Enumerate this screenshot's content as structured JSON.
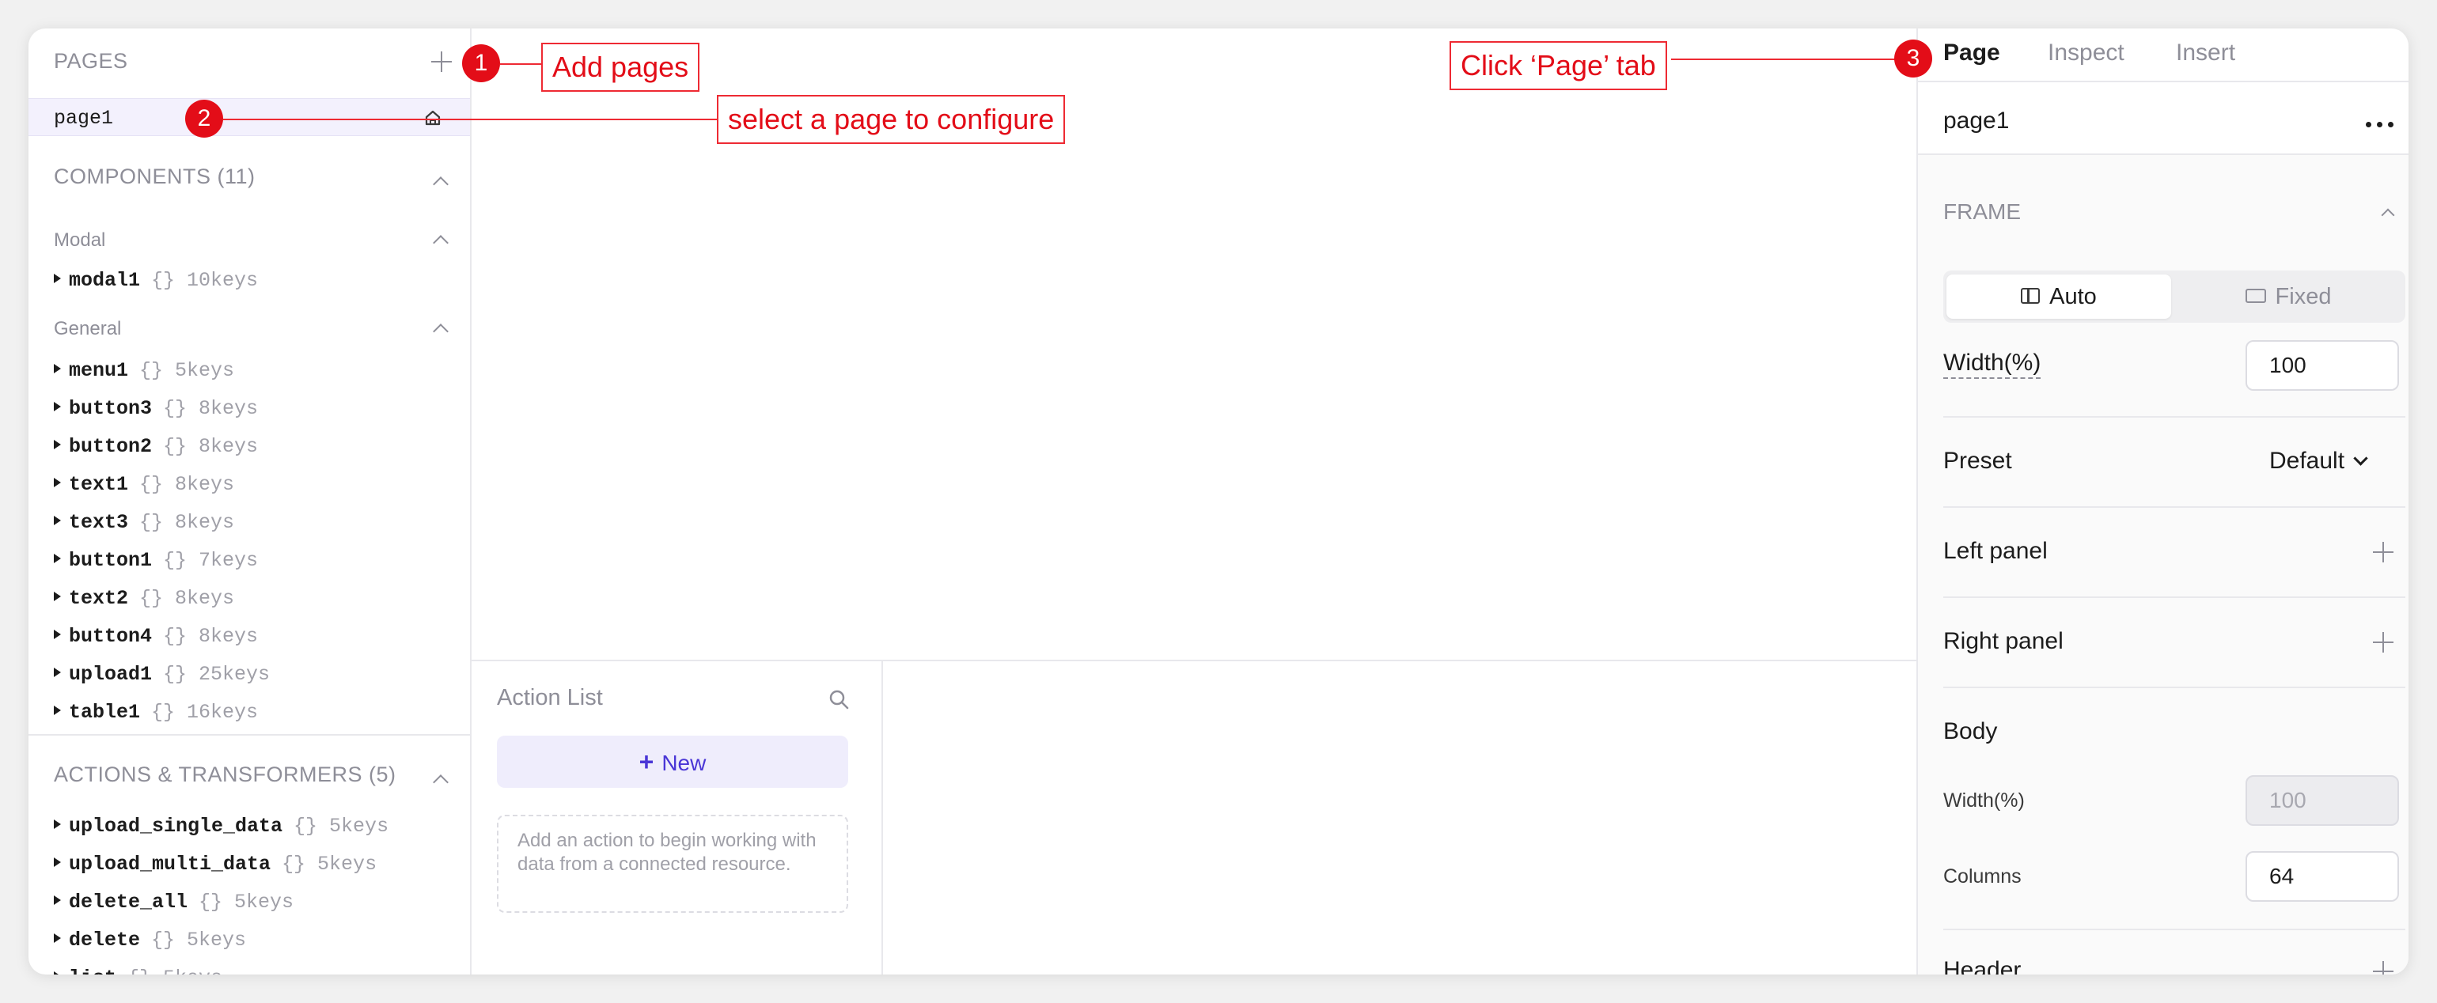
{
  "left_panel": {
    "pages_header": "PAGES",
    "pages": [
      {
        "name": "page1"
      }
    ],
    "components_header": "COMPONENTS (11)",
    "groups": [
      {
        "name": "Modal",
        "items": [
          {
            "name": "modal1",
            "keys": "{} 10keys"
          }
        ]
      },
      {
        "name": "General",
        "items": [
          {
            "name": "menu1",
            "keys": "{} 5keys"
          },
          {
            "name": "button3",
            "keys": "{} 8keys"
          },
          {
            "name": "button2",
            "keys": "{} 8keys"
          },
          {
            "name": "text1",
            "keys": "{} 8keys"
          },
          {
            "name": "text3",
            "keys": "{} 8keys"
          },
          {
            "name": "button1",
            "keys": "{} 7keys"
          },
          {
            "name": "text2",
            "keys": "{} 8keys"
          },
          {
            "name": "button4",
            "keys": "{} 8keys"
          },
          {
            "name": "upload1",
            "keys": "{} 25keys"
          },
          {
            "name": "table1",
            "keys": "{} 16keys"
          }
        ]
      }
    ],
    "actions_header": "ACTIONS & TRANSFORMERS (5)",
    "actions": [
      {
        "name": "upload_single_data",
        "keys": "{} 5keys"
      },
      {
        "name": "upload_multi_data",
        "keys": "{} 5keys"
      },
      {
        "name": "delete_all",
        "keys": "{} 5keys"
      },
      {
        "name": "delete",
        "keys": "{} 5keys"
      },
      {
        "name": "list",
        "keys": "{} 5keys"
      }
    ]
  },
  "action_list": {
    "title": "Action List",
    "new_label": "New",
    "empty_text": "Add an action to begin working with data from a connected resource."
  },
  "right_panel": {
    "tabs": [
      "Page",
      "Inspect",
      "Insert"
    ],
    "active_tab": "Page",
    "page_name": "page1",
    "frame_header": "FRAME",
    "frame_options": [
      "Auto",
      "Fixed"
    ],
    "frame_selected": "Auto",
    "width_label": "Width(%)",
    "width_value": "100",
    "preset_label": "Preset",
    "preset_value": "Default",
    "left_panel_label": "Left panel",
    "right_panel_label": "Right panel",
    "body_label": "Body",
    "body_width_label": "Width(%)",
    "body_width_value": "100",
    "columns_label": "Columns",
    "columns_value": "64",
    "header_label": "Header"
  },
  "annotations": [
    {
      "number": "1",
      "text": "Add pages"
    },
    {
      "number": "2",
      "text": "select a page to configure"
    },
    {
      "number": "3",
      "text": "Click ‘Page’ tab"
    }
  ],
  "colors": {
    "annotation": "#e30d18",
    "accent": "#4a36d6",
    "selected_row": "#f3f1fd"
  }
}
